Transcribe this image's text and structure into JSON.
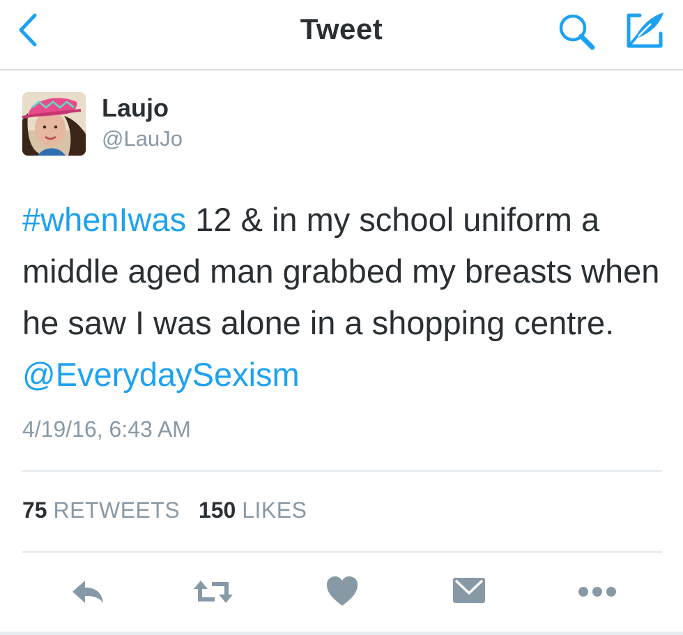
{
  "header": {
    "title": "Tweet"
  },
  "author": {
    "name": "Laujo",
    "handle": "@LauJo"
  },
  "tweet": {
    "hashtag": "#whenIwas",
    "text_main": " 12 & in my school uniform a middle aged man grabbed my breasts when he saw I was alone in a shopping centre. ",
    "mention": "@EverydaySexism",
    "timestamp": "4/19/16, 6:43 AM"
  },
  "stats": {
    "retweet_count": "75",
    "retweet_label": "RETWEETS",
    "like_count": "150",
    "like_label": "LIKES"
  },
  "icons": {
    "back": "chevron-left-icon",
    "search": "search-icon",
    "compose": "compose-icon",
    "reply": "reply-icon",
    "retweet": "retweet-icon",
    "like": "heart-icon",
    "message": "envelope-icon",
    "more": "more-icon"
  },
  "colors": {
    "accent": "#1da1f2",
    "text": "#292f33",
    "muted": "#8899a6",
    "action_icon": "#8899a6",
    "divider": "#e1e8ed"
  }
}
